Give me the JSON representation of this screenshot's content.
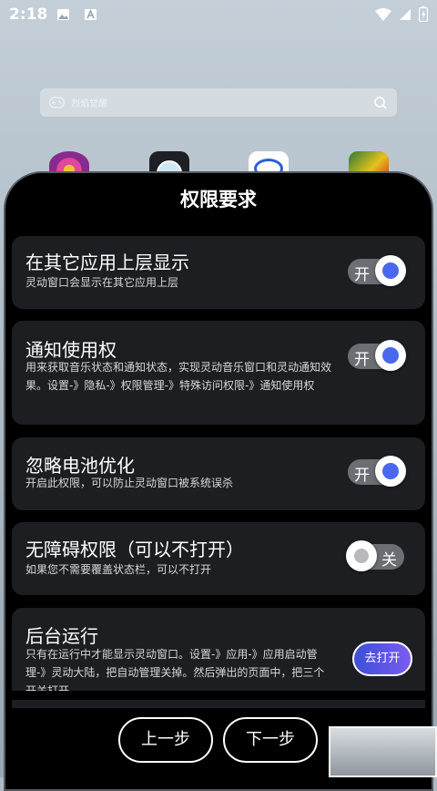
{
  "status": {
    "time": "2:18"
  },
  "search": {
    "placeholder": "烈焰觉醒"
  },
  "dialog": {
    "title": "权限要求",
    "permissions": [
      {
        "title": "在其它应用上层显示",
        "desc": "灵动窗口会显示在其它应用上层",
        "toggle": "开",
        "state": "on"
      },
      {
        "title": "通知使用权",
        "desc": "用来获取音乐状态和通知状态，实现灵动音乐窗口和灵动通知效果。设置-》隐私-》权限管理-》特殊访问权限-》通知使用权",
        "toggle": "开",
        "state": "on"
      },
      {
        "title": "忽略电池优化",
        "desc": "开启此权限，可以防止灵动窗口被系统误杀",
        "toggle": "开",
        "state": "on"
      },
      {
        "title": "无障碍权限（可以不打开）",
        "desc": "如果您不需要覆盖状态栏，可以不打开",
        "toggle": "关",
        "state": "off"
      },
      {
        "title": "后台运行",
        "desc": "只有在运行中才能显示灵动窗口。设置-》应用-》应用启动管理-》灵动大陆，把自动管理关掉。然后弹出的页面中，把三个开关打开",
        "button": "去打开"
      }
    ],
    "prev_label": "上一步",
    "next_label": "下一步"
  },
  "colors": {
    "accent": "#4a67f0",
    "card": "#1c1e22",
    "dialog_bg": "#000000"
  }
}
